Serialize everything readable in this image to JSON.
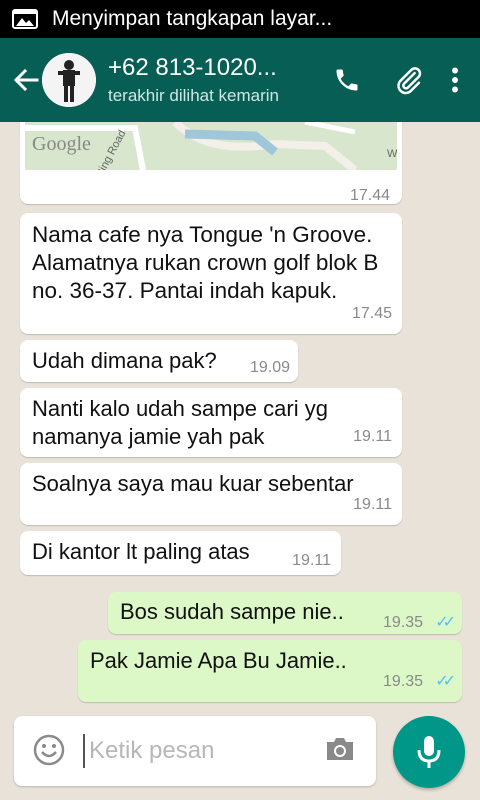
{
  "status_bar": {
    "notification_text": "Menyimpan tangkapan layar..."
  },
  "header": {
    "contact_name": "+62 813-1020...",
    "last_seen": "terakhir dilihat kemarin"
  },
  "map_message": {
    "map_label_google": "Google",
    "map_label_road": "Ring Road",
    "map_label_w": "W",
    "time": "17.44"
  },
  "messages": [
    {
      "text": "Nama cafe nya Tongue 'n Groove. Alamatnya rukan crown golf blok B no. 36-37. Pantai indah kapuk.",
      "time": "17.45",
      "direction": "in"
    },
    {
      "text": "Udah dimana pak?",
      "time": "19.09",
      "direction": "in"
    },
    {
      "text": "Nanti kalo udah sampe cari yg namanya jamie yah pak",
      "time": "19.11",
      "direction": "in"
    },
    {
      "text": "Soalnya saya mau kuar sebentar",
      "time": "19.11",
      "direction": "in"
    },
    {
      "text": "Di kantor lt paling atas",
      "time": "19.11",
      "direction": "in"
    },
    {
      "text": "Bos sudah sampe nie..",
      "time": "19.35",
      "direction": "out",
      "read": true
    },
    {
      "text": "Pak Jamie Apa Bu Jamie..",
      "time": "19.35",
      "direction": "out",
      "read": true
    }
  ],
  "composer": {
    "placeholder": "Ketik pesan"
  },
  "colors": {
    "header": "#075e54",
    "outgoing_bubble": "#dcf8c6",
    "mic_button": "#009688",
    "read_ticks": "#4fc3f7"
  }
}
